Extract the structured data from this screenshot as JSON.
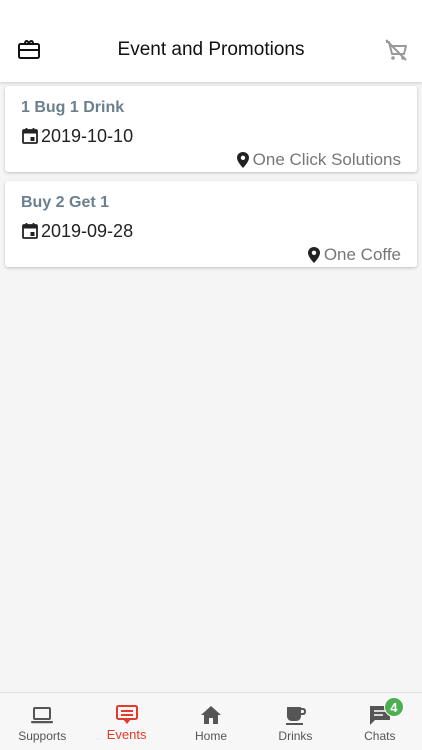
{
  "header": {
    "title": "Event and Promotions",
    "left_icon": "ticket-icon",
    "right_icon": "cart-off-icon"
  },
  "events": [
    {
      "name": "1 Bug 1 Drink",
      "date": "2019-10-10",
      "place": "One Click Solutions"
    },
    {
      "name": "Buy 2 Get 1",
      "date": "2019-09-28",
      "place": "One Coffe"
    }
  ],
  "tabs": [
    {
      "label": "Supports",
      "icon": "laptop-icon",
      "active": false
    },
    {
      "label": "Events",
      "icon": "event-icon",
      "active": true
    },
    {
      "label": "Home",
      "icon": "home-icon",
      "active": false
    },
    {
      "label": "Drinks",
      "icon": "coffee-icon",
      "active": false
    },
    {
      "label": "Chats",
      "icon": "chat-icon",
      "active": false,
      "badge": "4"
    }
  ],
  "colors": {
    "active_tab": "#e23b2e",
    "event_title": "#6b7f8e",
    "badge": "#4caf50"
  }
}
